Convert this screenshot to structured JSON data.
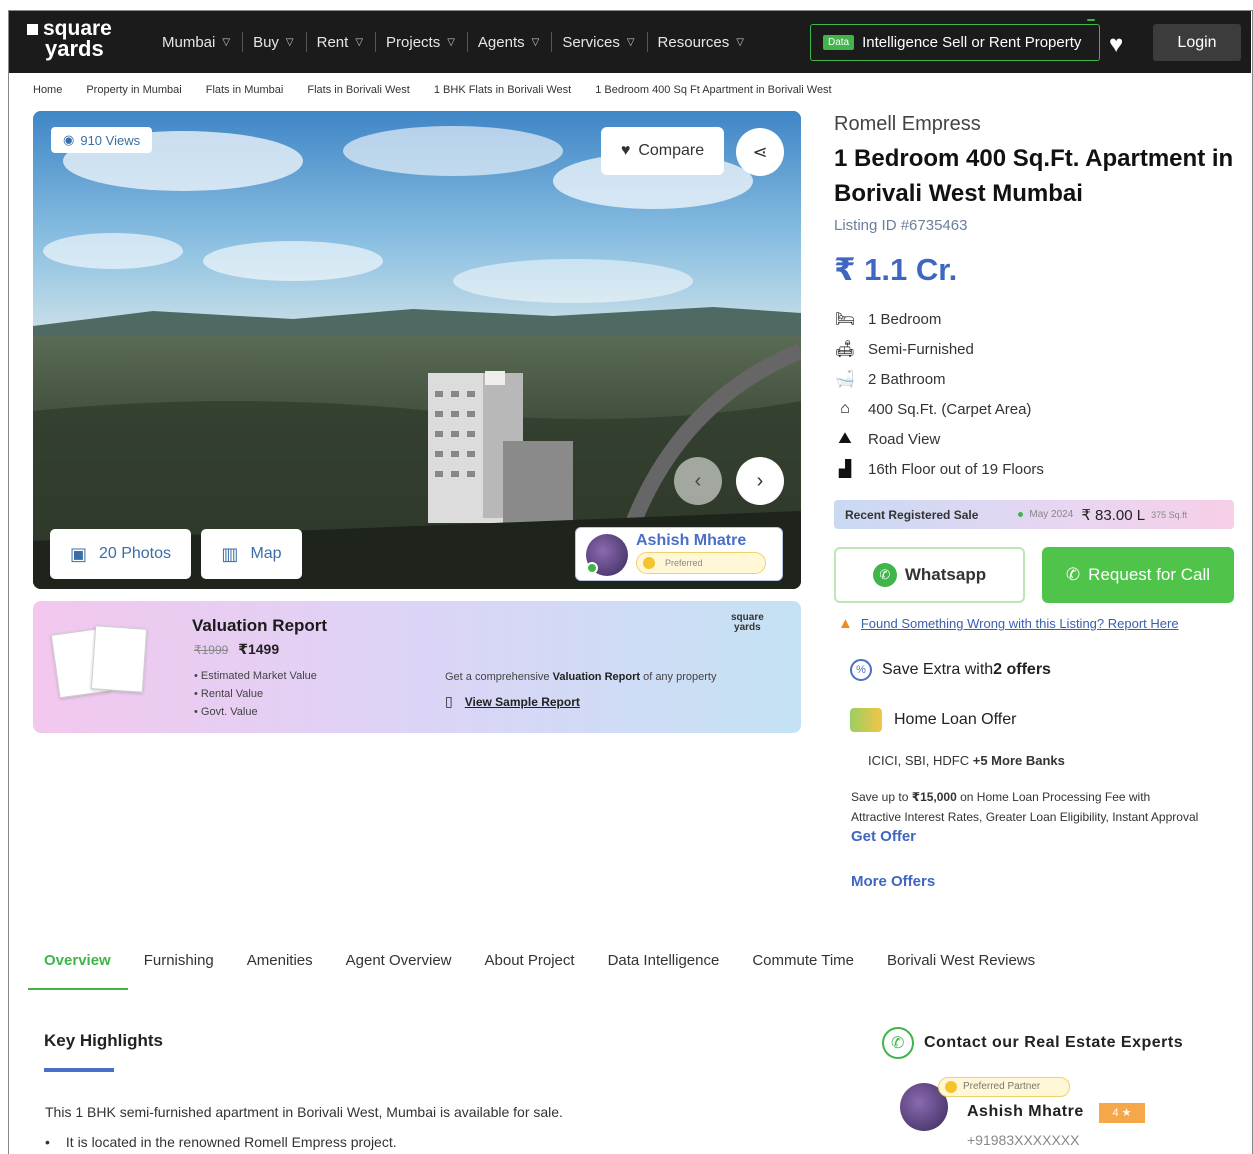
{
  "header": {
    "logo_line1": "square",
    "logo_line2": "yards",
    "nav": [
      {
        "label": "Mumbai"
      },
      {
        "label": "Buy"
      },
      {
        "label": "Rent"
      },
      {
        "label": "Projects"
      },
      {
        "label": "Agents"
      },
      {
        "label": "Services"
      },
      {
        "label": "Resources"
      }
    ],
    "intel_badge": "Data",
    "intel_label": "Intelligence Sell or Rent Property",
    "login_label": "Login"
  },
  "breadcrumb": [
    "Home",
    "Property in Mumbai",
    "Flats in Mumbai",
    "Flats in Borivali West",
    "1 BHK Flats in Borivali West",
    "1 Bedroom 400 Sq Ft Apartment in Borivali West"
  ],
  "hero": {
    "views": "910 Views",
    "compare_label": "Compare",
    "photos_label": "20 Photos",
    "map_label": "Map",
    "agent_name": "Ashish Mhatre",
    "agent_badge": "Preferred"
  },
  "valuation": {
    "title": "Valuation Report",
    "old_price": "₹1999",
    "price": "₹1499",
    "items": [
      "Estimated Market Value",
      "Rental Value",
      "Govt. Value"
    ],
    "logo_line1": "square",
    "logo_line2": "yards",
    "desc_prefix": "Get a comprehensive ",
    "desc_bold": "Valuation Report",
    "desc_suffix": " of any property",
    "sample_label": "View Sample Report"
  },
  "listing": {
    "project": "Romell Empress",
    "title": "1 Bedroom 400 Sq.Ft. Apartment in Borivali West Mumbai",
    "listing_id": "Listing ID #6735463",
    "price": "₹ 1.1 Cr.",
    "features": [
      {
        "icon": "bed-icon",
        "glyph": "🛏",
        "text": "1 Bedroom"
      },
      {
        "icon": "sofa-icon",
        "glyph": "🛋",
        "text": "Semi-Furnished"
      },
      {
        "icon": "bathtub-icon",
        "glyph": "🛁",
        "text": "2 Bathroom"
      },
      {
        "icon": "home-icon",
        "glyph": "⌂",
        "text": "400 Sq.Ft. (Carpet Area)"
      },
      {
        "icon": "road-view-icon",
        "glyph": "⛰",
        "text": "Road View"
      },
      {
        "icon": "floor-icon",
        "glyph": "▟",
        "text": "16th Floor out of 19 Floors"
      }
    ],
    "recent_label": "Recent Registered Sale",
    "recent_date": "May 2024",
    "recent_amount": "₹ 83.00 L",
    "recent_size": "375 Sq.ft",
    "whatsapp_label": "Whatsapp",
    "call_label": "Request for Call",
    "report_label": "Found Something Wrong with this Listing? Report Here",
    "offers_prefix": "Save Extra with ",
    "offers_count": "2 offers",
    "loan_title": "Home Loan Offer",
    "banks_prefix": "ICICI, SBI, HDFC ",
    "banks_more": "+5 More Banks",
    "loan_desc_a": "Save up to ",
    "loan_desc_amount": "₹15,000",
    "loan_desc_b": " on Home Loan Processing Fee with Attractive Interest Rates, Greater Loan Eligibility, Instant Approval",
    "get_offer": "Get Offer",
    "more_offers": "More Offers"
  },
  "tabs": [
    "Overview",
    "Furnishing",
    "Amenities",
    "Agent Overview",
    "About Project",
    "Data Intelligence",
    "Commute Time",
    "Borivali West Reviews"
  ],
  "content": {
    "key_highlights": "Key Highlights",
    "description": "This 1 BHK semi-furnished apartment in Borivali West, Mumbai is available for sale.",
    "bullet1": "It is located in the renowned Romell Empress project."
  },
  "contact": {
    "title": "Contact our Real Estate Experts",
    "badge": "Preferred Partner",
    "name": "Ashish Mhatre",
    "rating": "4 ★",
    "phone": "+91983XXXXXXX"
  },
  "colors": {
    "accent_blue": "#3f66c1",
    "accent_green": "#3fb54a",
    "header_bg": "#1b1b1b"
  }
}
